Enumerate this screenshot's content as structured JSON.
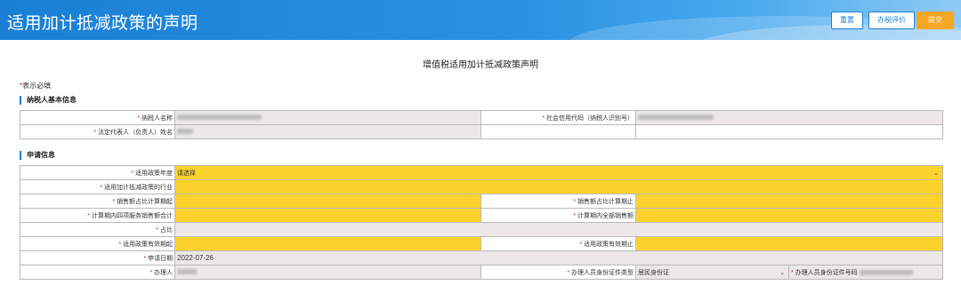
{
  "header": {
    "title": "适用加计抵减政策的声明",
    "buttons": {
      "reset": "重置",
      "evaluate": "办税评价",
      "submit": "提交"
    }
  },
  "document_title": "增值税适用加计抵减政策声明",
  "required_note": {
    "mark": "*",
    "text": "表示必填"
  },
  "taxpayer_section": {
    "title": "纳税人基本信息",
    "name_label": "纳税人名称",
    "credit_code_label": "社会信用代码（纳税人识别号）",
    "legal_rep_label": "法定代表人（负责人）姓名"
  },
  "application_section": {
    "title": "申请信息",
    "policy_year": {
      "label": "适用政策年度",
      "placeholder": "请选择"
    },
    "industry_label": "适用加计抵减政策的行业",
    "sales_period_start_label": "销售额占比计算期起",
    "sales_period_end_label": "销售额占比计算期止",
    "four_service_sales_label": "计算期内四项服务销售额合计",
    "total_sales_label": "计算期内全部销售额",
    "ratio_label": "占比",
    "valid_start_label": "适用政策有效期起",
    "valid_end_label": "适用政策有效期止",
    "apply_date_label": "申请日期",
    "apply_date_value": "2022-07-26",
    "handler_label": "办理人",
    "handler_id_type_label": "办理人员身份证件类型",
    "handler_id_type_value": "居民身份证",
    "handler_id_number_label": "办理人员身份证件号码"
  },
  "colors": {
    "header_blue": "#1a7fd4",
    "required_yellow": "#fdd22c",
    "readonly_gray": "#ece8e8",
    "submit_orange": "#f5a623"
  }
}
